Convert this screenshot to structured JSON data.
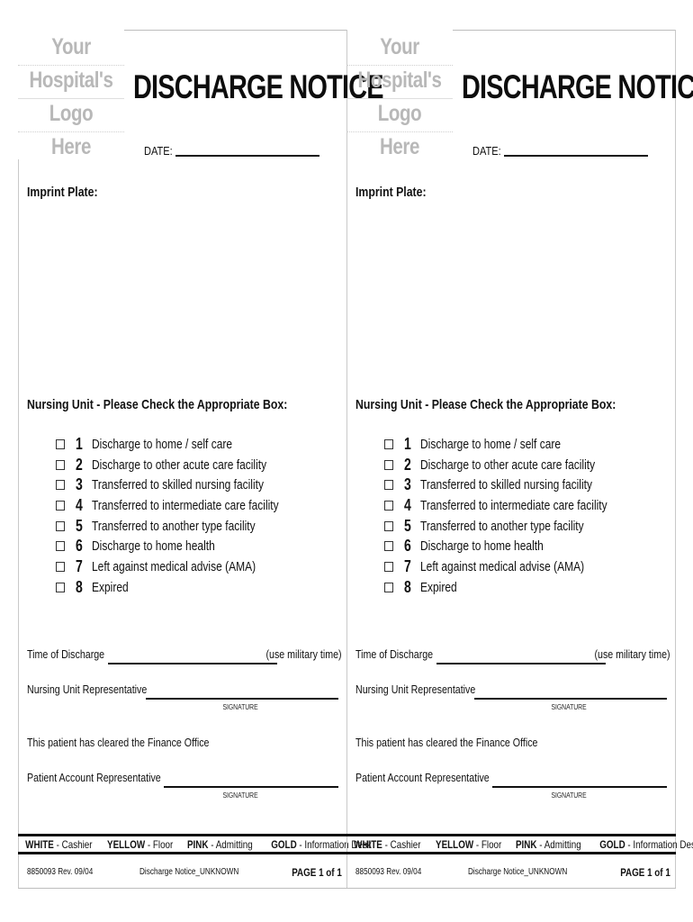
{
  "forms": [
    {
      "logo_lines": [
        "Your",
        "Hospital's",
        "Logo",
        "Here"
      ],
      "title": "DISCHARGE NOTICE",
      "date_label": "DATE:",
      "imprint_label": "Imprint Plate:",
      "nursing_heading": "Nursing Unit - Please Check the Appropriate Box:",
      "options": [
        {
          "num": "1",
          "text": "Discharge to home / self care",
          "checked": false
        },
        {
          "num": "2",
          "text": "Discharge to other acute care facility",
          "checked": false
        },
        {
          "num": "3",
          "text": "Transferred to skilled nursing facility",
          "checked": false
        },
        {
          "num": "4",
          "text": "Transferred to intermediate care facility",
          "checked": false
        },
        {
          "num": "5",
          "text": "Transferred to another type facility",
          "checked": false
        },
        {
          "num": "6",
          "text": "Discharge to home health",
          "checked": false
        },
        {
          "num": "7",
          "text": "Left against medical advise (AMA)",
          "checked": false
        },
        {
          "num": "8",
          "text": "Expired",
          "checked": false
        }
      ],
      "time_label": "Time of Discharge",
      "time_hint": "(use military time)",
      "nursing_rep_label": "Nursing Unit Representative",
      "signature_label": "SIGNATURE",
      "finance_text": "This patient has cleared the Finance Office",
      "patient_rep_label": "Patient Account Representative",
      "copies": [
        {
          "color": "WHITE",
          "dest": " - Cashier"
        },
        {
          "color": "YELLOW",
          "dest": " - Floor"
        },
        {
          "color": "PINK",
          "dest": " - Admitting"
        },
        {
          "color": "GOLD",
          "dest": " - Information Desk"
        }
      ],
      "form_code": "8850093  Rev. 09/04",
      "doc_name": "Discharge Notice_UNKNOWN",
      "page": "PAGE 1 of 1"
    },
    {
      "logo_lines": [
        "Your",
        "Hospital's",
        "Logo",
        "Here"
      ],
      "title": "DISCHARGE NOTICE",
      "date_label": "DATE:",
      "imprint_label": "Imprint Plate:",
      "nursing_heading": "Nursing Unit - Please Check the Appropriate Box:",
      "options": [
        {
          "num": "1",
          "text": "Discharge to home / self care",
          "checked": false
        },
        {
          "num": "2",
          "text": "Discharge to other acute care facility",
          "checked": false
        },
        {
          "num": "3",
          "text": "Transferred to skilled nursing facility",
          "checked": false
        },
        {
          "num": "4",
          "text": "Transferred to intermediate care facility",
          "checked": false
        },
        {
          "num": "5",
          "text": "Transferred to another type facility",
          "checked": false
        },
        {
          "num": "6",
          "text": "Discharge to home health",
          "checked": false
        },
        {
          "num": "7",
          "text": "Left against medical advise (AMA)",
          "checked": false
        },
        {
          "num": "8",
          "text": "Expired",
          "checked": false
        }
      ],
      "time_label": "Time of Discharge",
      "time_hint": "(use military time)",
      "nursing_rep_label": "Nursing Unit Representative",
      "signature_label": "SIGNATURE",
      "finance_text": "This patient has cleared the Finance Office",
      "patient_rep_label": "Patient Account Representative",
      "copies": [
        {
          "color": "WHITE",
          "dest": " - Cashier"
        },
        {
          "color": "YELLOW",
          "dest": " - Floor"
        },
        {
          "color": "PINK",
          "dest": " - Admitting"
        },
        {
          "color": "GOLD",
          "dest": " - Information Desk"
        }
      ],
      "form_code": "8850093  Rev. 09/04",
      "doc_name": "Discharge Notice_UNKNOWN",
      "page": "PAGE 1 of 1"
    }
  ]
}
